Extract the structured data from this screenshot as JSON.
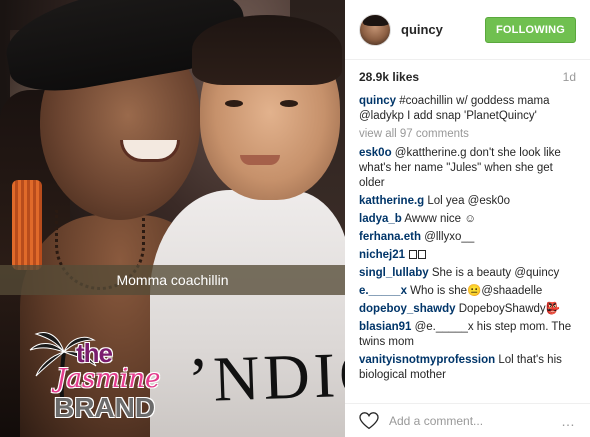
{
  "photo": {
    "snap_caption": "Momma coachillin",
    "shirt_text": "’NDIO",
    "watermark": {
      "the": "the",
      "jasmine": "Jasmine",
      "brand": "BRAND"
    }
  },
  "header": {
    "username": "quincy",
    "follow_label": "FOLLOWING",
    "follow_color": "#70c050"
  },
  "stats": {
    "likes": "28.9k likes",
    "age": "1d"
  },
  "caption": {
    "user": "quincy",
    "text": " #coachillin w/ goddess mama @ladykp I add snap 'PlanetQuincy'"
  },
  "view_all": "view all 97 comments",
  "comments": [
    {
      "user": "esk0o",
      "text": " @kattherine.g don't she look like what's her name \"Jules\" when she get older"
    },
    {
      "user": "kattherine.g",
      "text": " Lol yea @esk0o"
    },
    {
      "user": "ladya_b",
      "text": " Awww nice ☺"
    },
    {
      "user": "ferhana.eth",
      "text": " @lllyxo__"
    },
    {
      "user": "nichej21",
      "text": " "
    },
    {
      "user": "singl_lullaby",
      "text": " She is a beauty @quincy"
    },
    {
      "user": "e._____x",
      "text": " Who is she😐@shaadelle"
    },
    {
      "user": "dopeboy_shawdy",
      "text": " DopeboyShawdy👺"
    },
    {
      "user": "blasian91",
      "text": " @e._____x his step mom. The twins mom"
    },
    {
      "user": "vanityisnotmyprofession",
      "text": " Lol that's his biological mother"
    }
  ],
  "footer": {
    "add_comment_placeholder": "Add a comment...",
    "more_label": "…",
    "heart_icon": "heart-icon"
  }
}
